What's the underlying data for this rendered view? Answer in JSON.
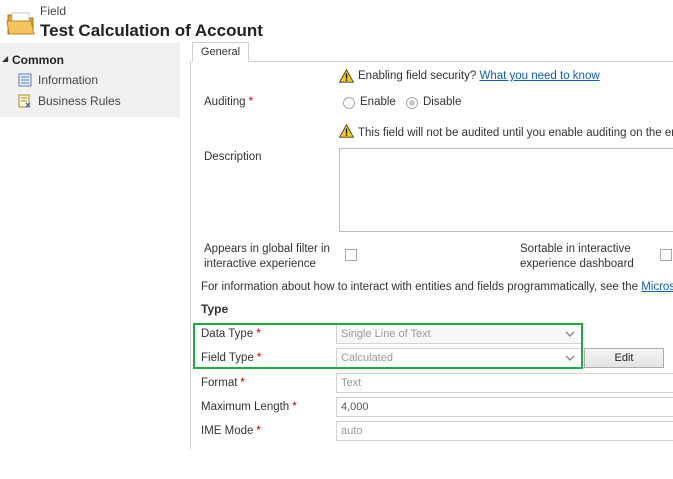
{
  "header": {
    "entity_type": "Field",
    "title": "Test Calculation of Account"
  },
  "nav": {
    "section_label": "Common",
    "items": [
      {
        "label": "Information",
        "icon": "form-icon"
      },
      {
        "label": "Business Rules",
        "icon": "business-rules-icon"
      }
    ]
  },
  "tabs": [
    {
      "label": "General"
    }
  ],
  "form": {
    "field_security": {
      "text": "Enabling field security?",
      "link": "What you need to know"
    },
    "auditing": {
      "label": "Auditing",
      "options": [
        "Enable",
        "Disable"
      ],
      "selected": "Disable",
      "notice": "This field will not be audited until you enable auditing on the enti"
    },
    "description": {
      "label": "Description",
      "value": ""
    },
    "global_filter": {
      "label_line1": "Appears in global filter in",
      "label_line2": "interactive experience",
      "checked": false
    },
    "sortable": {
      "label_line1": "Sortable in interactive",
      "label_line2": "experience dashboard",
      "checked": false
    },
    "info_text": "For information about how to interact with entities and fields programmatically, see the",
    "info_link": "Microsof",
    "type_section": "Type",
    "data_type": {
      "label": "Data Type",
      "value": "Single Line of Text"
    },
    "field_type": {
      "label": "Field Type",
      "value": "Calculated",
      "edit_label": "Edit"
    },
    "format": {
      "label": "Format",
      "value": "Text"
    },
    "max_length": {
      "label": "Maximum Length",
      "value": "4,000"
    },
    "ime_mode": {
      "label": "IME Mode",
      "value": "auto"
    },
    "required_marker": "*"
  },
  "colors": {
    "highlight": "#21a83f",
    "required": "#c00000",
    "link": "#1060b0"
  }
}
